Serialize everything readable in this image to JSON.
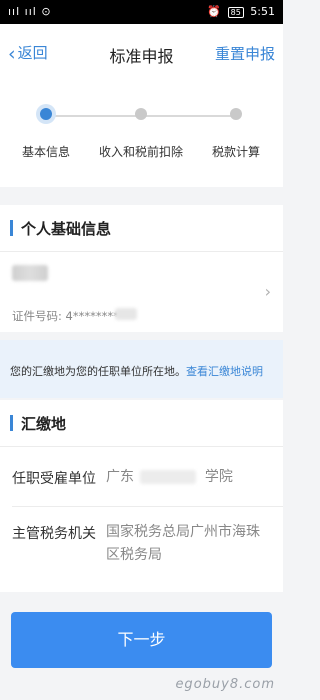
{
  "status_bar": {
    "left_icons": "ııl ııl ⊙",
    "alarm": "⏰",
    "battery": "85",
    "time": "5:51"
  },
  "nav": {
    "back_label": "返回",
    "title": "标准申报",
    "reset_label": "重置申报"
  },
  "steps": [
    {
      "label": "基本信息",
      "active": true
    },
    {
      "label": "收入和税前扣除",
      "active": false
    },
    {
      "label": "税款计算",
      "active": false
    }
  ],
  "personal": {
    "section_title": "个人基础信息",
    "id_label": "证件号码: ",
    "id_value": "4**********"
  },
  "notice": {
    "text": "您的汇缴地为您的任职单位所在地。",
    "link": "查看汇缴地说明"
  },
  "remit": {
    "section_title": "汇缴地",
    "employer_label": "任职受雇单位",
    "employer_value_start": "广东",
    "employer_value_end": "学院",
    "tax_office_label": "主管税务机关",
    "tax_office_value": "国家税务总局广州市海珠区税务局"
  },
  "next_button": "下一步",
  "watermark": "egobuy8.com"
}
